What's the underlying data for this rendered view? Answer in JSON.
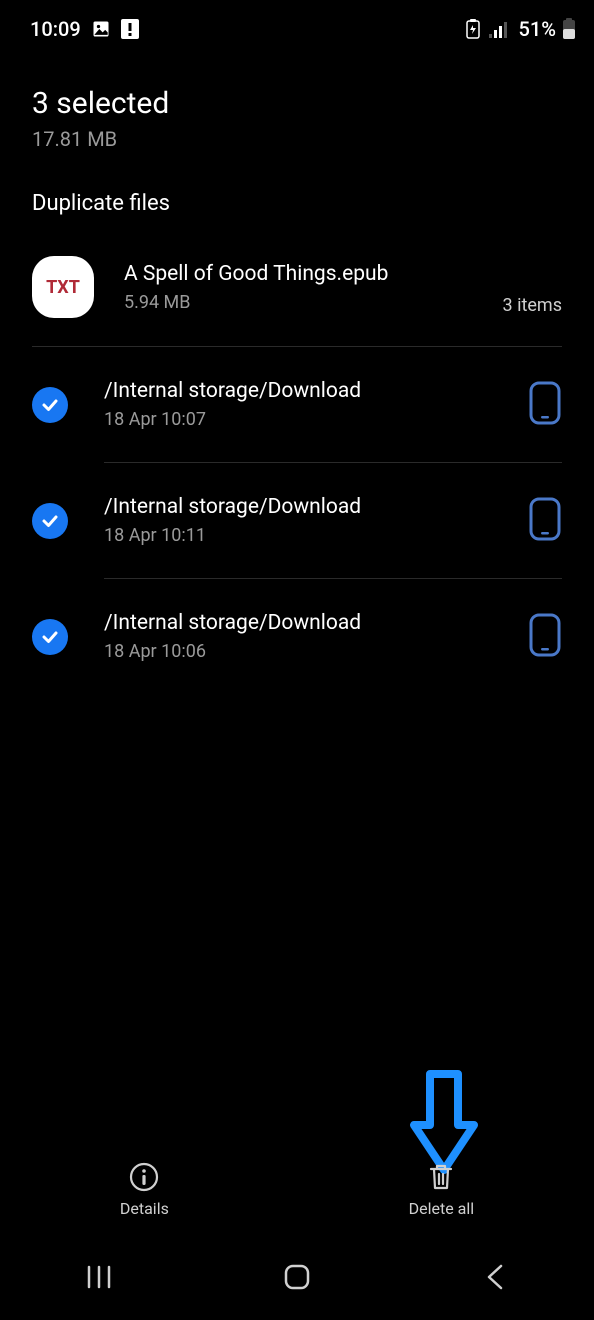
{
  "statusbar": {
    "time": "10:09",
    "battery_text": "51%"
  },
  "header": {
    "title": "3 selected",
    "subtitle": "17.81 MB"
  },
  "section": {
    "title": "Duplicate files"
  },
  "group": {
    "badge": "TXT",
    "name": "A Spell of Good Things.epub",
    "size": "5.94 MB",
    "count": "3 items"
  },
  "rows": [
    {
      "path": "/Internal storage/Download",
      "date": "18 Apr 10:07"
    },
    {
      "path": "/Internal storage/Download",
      "date": "18 Apr 10:11"
    },
    {
      "path": "/Internal storage/Download",
      "date": "18 Apr 10:06"
    }
  ],
  "actions": {
    "details": "Details",
    "delete_all": "Delete all"
  }
}
